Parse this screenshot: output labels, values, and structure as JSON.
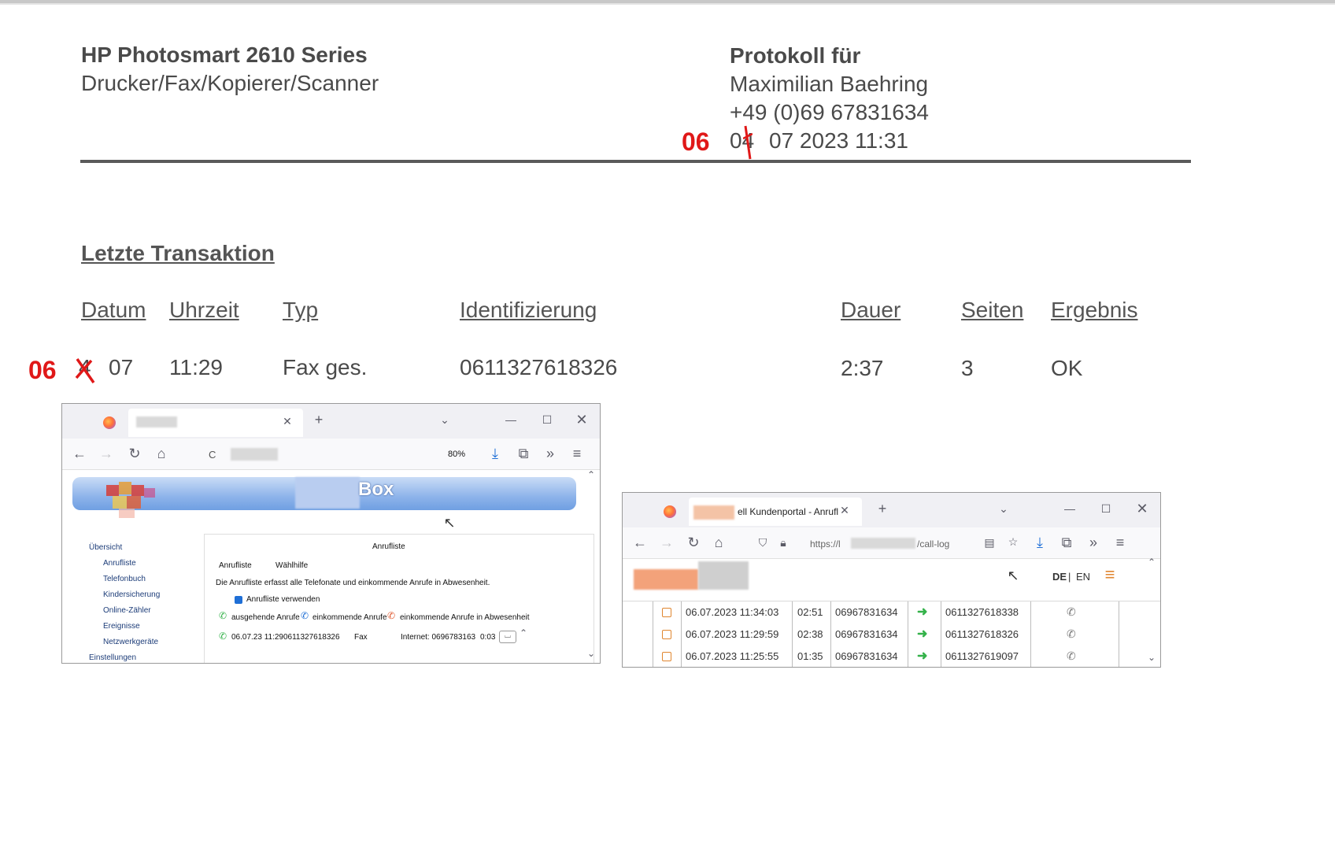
{
  "header": {
    "device_line1": "HP Photosmart 2610 Series",
    "device_line2": "Drucker/Fax/Kopierer/Scanner",
    "report_title": "Protokoll für",
    "name": "Maximilian Baehring",
    "phone": "+49 (0)69 67831634",
    "date_day_struck": "04",
    "date_rest": "07 2023 11:31",
    "date_correction": "06"
  },
  "transaction": {
    "title": "Letzte Transaktion",
    "columns": [
      "Datum",
      "Uhrzeit",
      "Typ",
      "Identifizierung",
      "Dauer",
      "Seiten",
      "Ergebnis"
    ],
    "row": {
      "date_correction": "06",
      "date_struck": "4",
      "date_month": "07",
      "time": "11:29",
      "type": "Fax ges.",
      "identification": "0611327618326",
      "duration": "2:37",
      "pages": "3",
      "result": "OK"
    }
  },
  "screenshot_left": {
    "zoom": "80%",
    "url_prefix": "C",
    "banner_suffix": "Box",
    "nav": [
      "Übersicht",
      "Anrufliste",
      "Telefonbuch",
      "Kindersicherung",
      "Online-Zähler",
      "Ereignisse",
      "Netzwerkgeräte",
      "Einstellungen"
    ],
    "panel_title": "Anrufliste",
    "tabs": [
      "Anrufliste",
      "Wählhilfe"
    ],
    "description": "Die Anrufliste erfasst alle Telefonate und einkommende Anrufe in Abwesenheit.",
    "checkbox_label": "Anrufliste verwenden",
    "legend": [
      "ausgehende Anrufe",
      "einkommende Anrufe",
      "einkommende Anrufe in Abwesenheit"
    ],
    "entry": {
      "datetime_number": "06.07.23 11:290611327618326",
      "type": "Fax",
      "line": "Internet: 0696783163",
      "duration": "0:03"
    }
  },
  "screenshot_right": {
    "tab_title": "ell Kundenportal - Anrufl",
    "url_prefix": "https://l",
    "url_suffix": "/call-log",
    "lang": {
      "de": "DE",
      "sep": "|",
      "en": "EN"
    },
    "rows": [
      {
        "datetime": "06.07.2023 11:34:03",
        "duration": "02:51",
        "from": "06967831634",
        "to": "0611327618338"
      },
      {
        "datetime": "06.07.2023 11:29:59",
        "duration": "02:38",
        "from": "06967831634",
        "to": "0611327618326"
      },
      {
        "datetime": "06.07.2023 11:25:55",
        "duration": "01:35",
        "from": "06967831634",
        "to": "0611327619097"
      }
    ]
  },
  "colors": {
    "annotation_red": "#e01818",
    "text_gray": "#4a4a4a",
    "link_blue": "#1c3c78",
    "arrow_green": "#34b24a"
  }
}
